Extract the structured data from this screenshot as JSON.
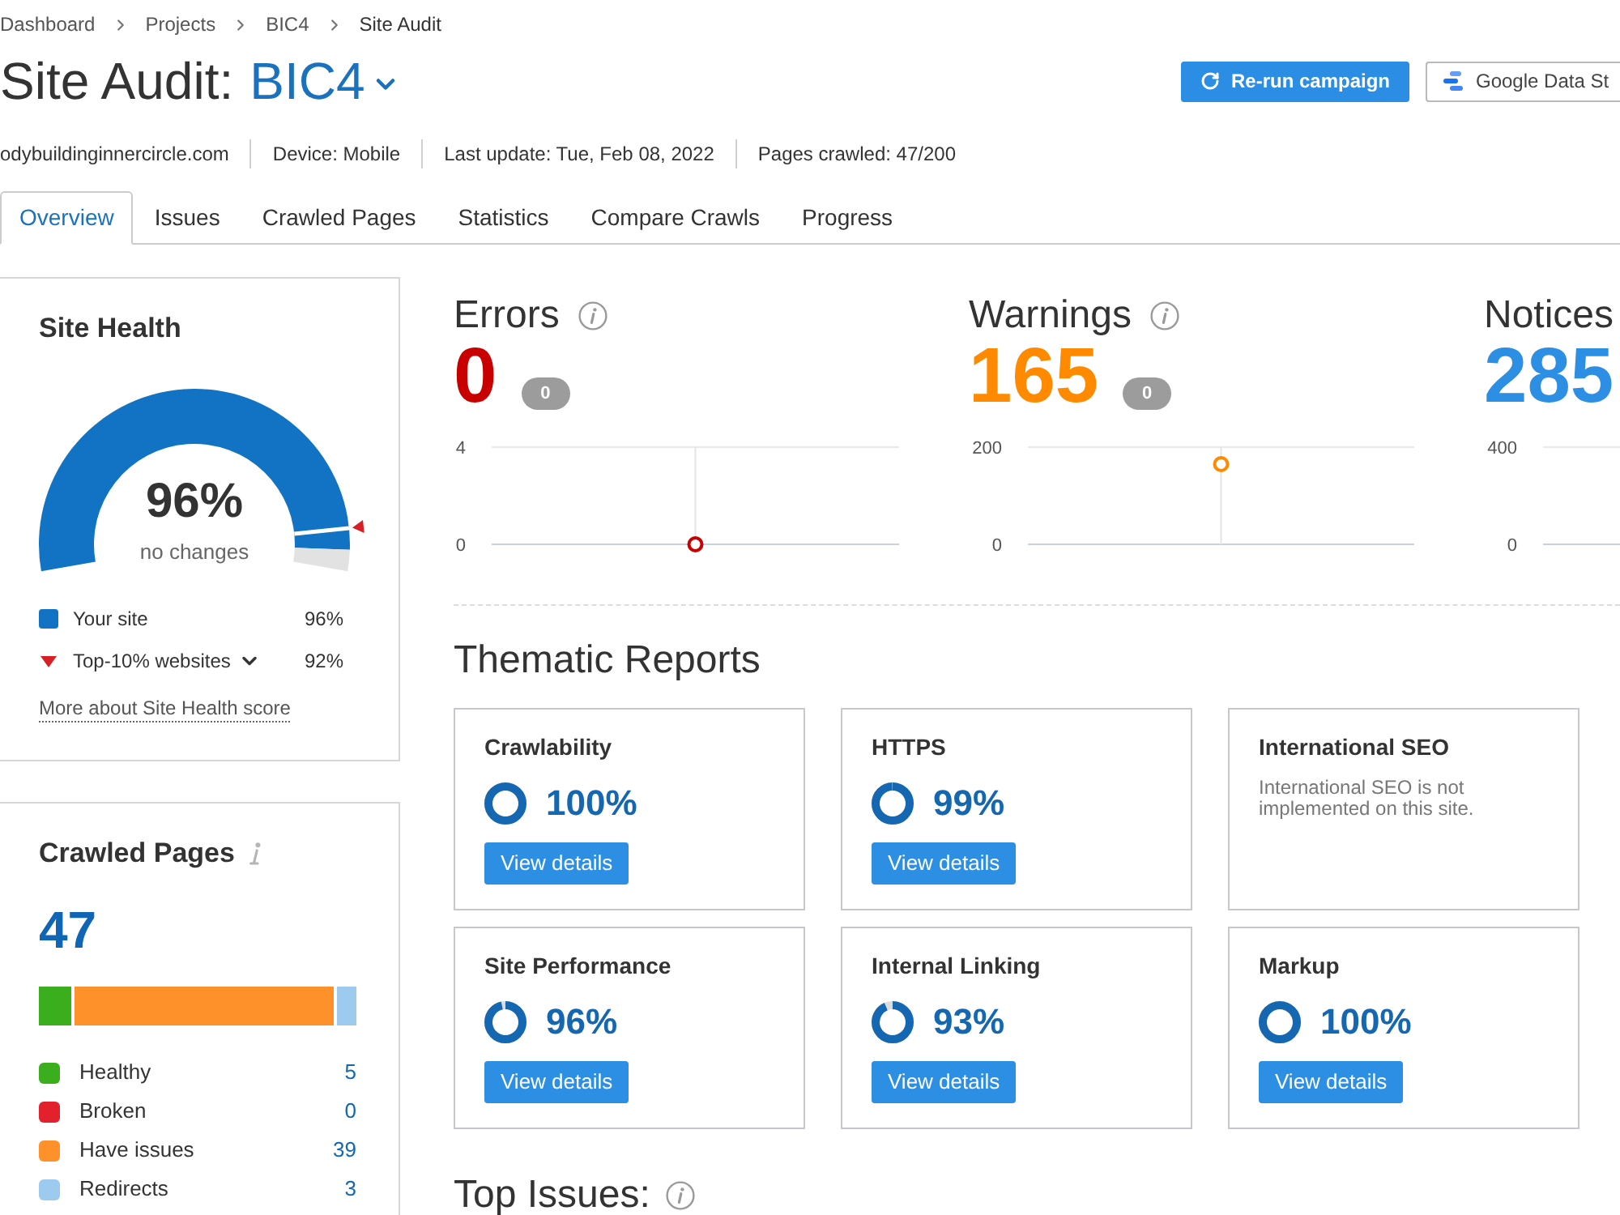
{
  "breadcrumb": [
    {
      "label": "Dashboard"
    },
    {
      "label": "Projects"
    },
    {
      "label": "BIC4"
    },
    {
      "label": "Site Audit"
    }
  ],
  "title": {
    "text": "Site Audit:",
    "project": "BIC4"
  },
  "actions": [
    {
      "kind": "rerun",
      "label": "Re-run campaign"
    },
    {
      "kind": "datastudio",
      "label": "Google Data St"
    }
  ],
  "info": [
    {
      "text": "odybuildinginnercircle.com"
    },
    {
      "text": "Device: Mobile"
    },
    {
      "text": "Last update: Tue, Feb 08, 2022"
    },
    {
      "text": "Pages crawled: 47/200"
    }
  ],
  "tabs": [
    {
      "label": "Overview",
      "selected": true
    },
    {
      "label": "Issues",
      "selected": false
    },
    {
      "label": "Crawled Pages",
      "selected": false
    },
    {
      "label": "Statistics",
      "selected": false
    },
    {
      "label": "Compare Crawls",
      "selected": false
    },
    {
      "label": "Progress",
      "selected": false
    }
  ],
  "site_health": {
    "title": "Site Health",
    "score": "96%",
    "change": "no changes",
    "gauge": {
      "level": 0.96,
      "marker": {
        "level": 0.92
      }
    },
    "legend": [
      {
        "kind": "site",
        "label": "Your site",
        "value": "96%"
      },
      {
        "kind": "benchmark",
        "label": "Top-10% websites",
        "value": "92%"
      }
    ],
    "link": "More about Site Health score"
  },
  "crawled_pages": {
    "title": "Crawled Pages",
    "total": "47",
    "categories": [
      {
        "label": "Healthy",
        "count": "5",
        "color": "#3aae1c"
      },
      {
        "label": "Broken",
        "count": "0",
        "color": "#e3212d"
      },
      {
        "label": "Have issues",
        "count": "39",
        "color": "#ff912b"
      },
      {
        "label": "Redirects",
        "count": "3",
        "color": "#9dcbf0"
      }
    ]
  },
  "issues": [
    {
      "kind": "errors",
      "title": "Errors",
      "count": "0",
      "badge": "0",
      "info_icon": true,
      "chart_data": {
        "type": "line",
        "series": [
          {
            "color": "#c90000",
            "marker": "circle",
            "values": [
              0
            ]
          }
        ],
        "ylim": [
          0,
          4
        ],
        "yticks": [
          0,
          4
        ]
      }
    },
    {
      "kind": "warnings",
      "title": "Warnings",
      "count": "165",
      "badge": "0",
      "info_icon": true,
      "chart_data": {
        "type": "line",
        "series": [
          {
            "color": "#ff8a00",
            "marker": "circle",
            "values": [
              165
            ]
          }
        ],
        "ylim": [
          0,
          200
        ],
        "yticks": [
          0,
          200
        ]
      }
    },
    {
      "kind": "notices",
      "title": "Notices",
      "count": "285",
      "info_icon": false,
      "axis_labels": [
        "400",
        "0"
      ]
    }
  ],
  "thematic_reports": {
    "title": "Thematic Reports",
    "reports": [
      {
        "kind": "score",
        "title": "Crawlability",
        "score": "100%",
        "button": "View details"
      },
      {
        "kind": "score",
        "title": "HTTPS",
        "score": "99%",
        "button": "View details"
      },
      {
        "kind": "note",
        "title": "International SEO",
        "note": "International SEO is not implemented on this site."
      },
      {
        "kind": "score",
        "title": "Site Performance",
        "score": "96%",
        "button": "View details"
      },
      {
        "kind": "score",
        "title": "Internal Linking",
        "score": "93%",
        "button": "View details"
      },
      {
        "kind": "score",
        "title": "Markup",
        "score": "100%",
        "button": "View details"
      }
    ]
  },
  "top_issues": {
    "title": "Top Issues:"
  }
}
